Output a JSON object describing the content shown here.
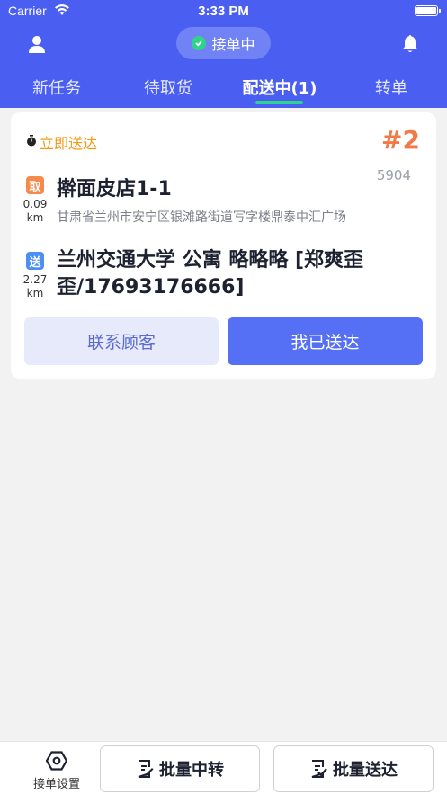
{
  "status_bar": {
    "carrier": "Carrier",
    "time": "3:33 PM"
  },
  "header": {
    "status_pill": "接单中",
    "tabs": [
      {
        "label": "新任务"
      },
      {
        "label": "待取货"
      },
      {
        "label": "配送中(1)"
      },
      {
        "label": "转单"
      }
    ],
    "active_tab": 2,
    "accent_color": "#4a5ff2",
    "indicator_color": "#2fd38a"
  },
  "order": {
    "delivery_type": "立即送达",
    "order_no": "#2",
    "order_id": "5904",
    "pickup": {
      "badge": "取",
      "distance_value": "0.09",
      "distance_unit": "km",
      "name": "擀面皮店1-1",
      "address": "甘肃省兰州市安宁区银滩路街道写字楼鼎泰中汇广场"
    },
    "dropoff": {
      "badge": "送",
      "distance_value": "2.27",
      "distance_unit": "km",
      "address": "兰州交通大学 公寓 略略略 [郑爽歪歪/17693176666]"
    },
    "buttons": {
      "contact": "联系顾客",
      "delivered": "我已送达"
    }
  },
  "bottom_bar": {
    "settings_label": "接单设置",
    "batch_transfer": "批量中转",
    "batch_deliver": "批量送达"
  }
}
